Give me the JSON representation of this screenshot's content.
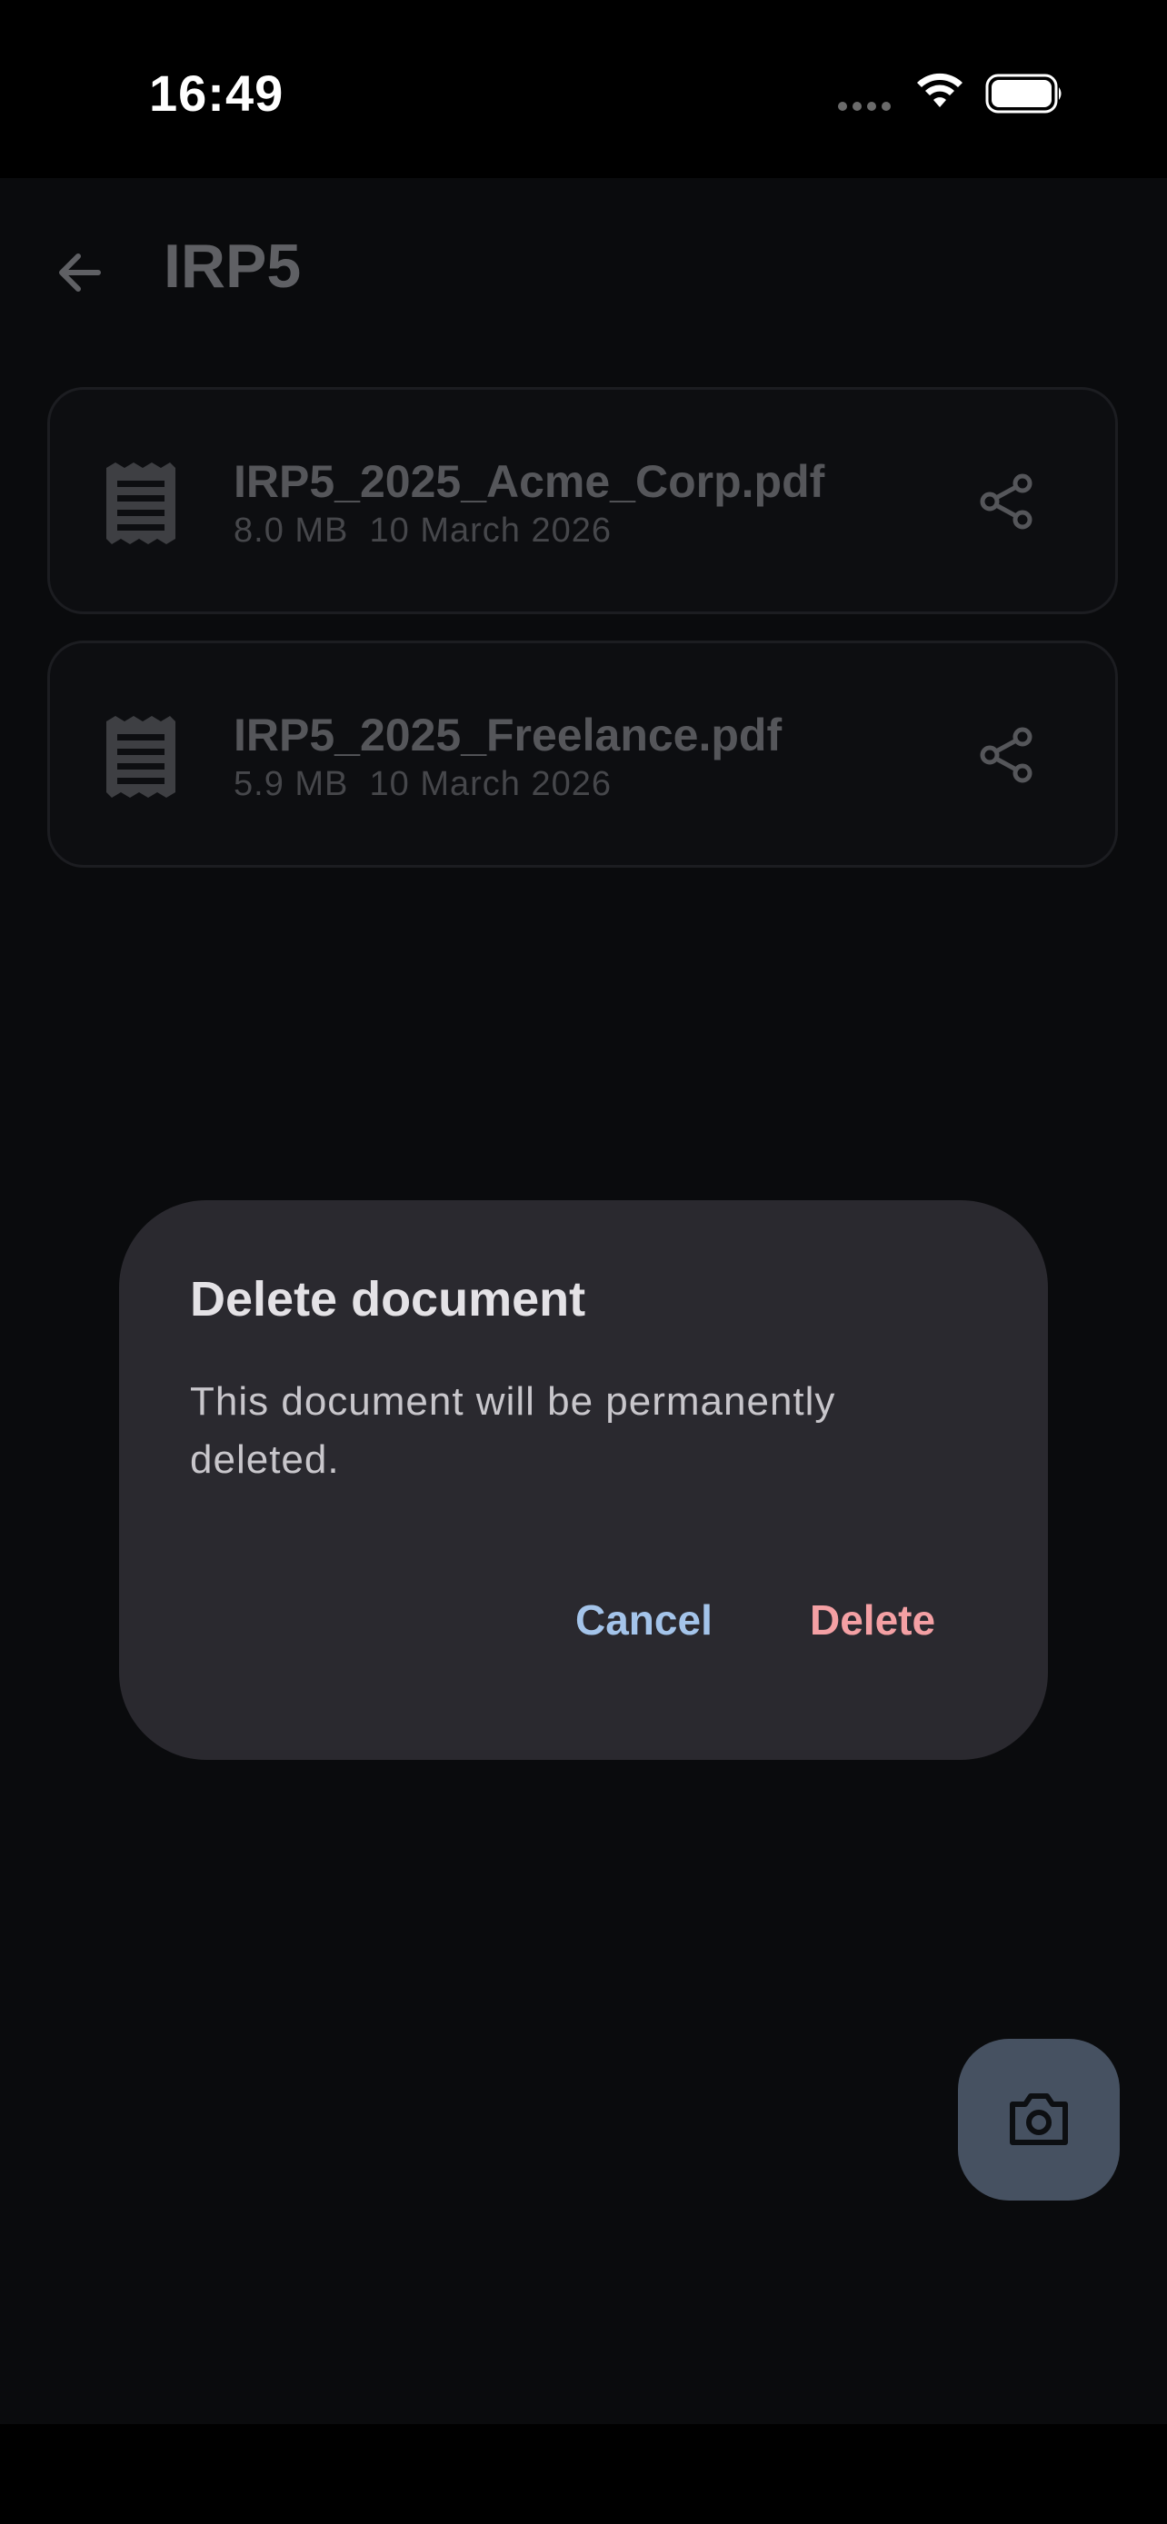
{
  "status_bar": {
    "time": "16:49",
    "signal_icon": "signal-dots-icon",
    "wifi_icon": "wifi-icon",
    "battery_icon": "battery-icon"
  },
  "header": {
    "back_icon": "arrow-left-icon",
    "title": "IRP5"
  },
  "documents": [
    {
      "icon": "receipt-icon",
      "name": "IRP5_2025_Acme_Corp.pdf",
      "meta": "8.0 MB  10 March 2026",
      "share_icon": "share-icon"
    },
    {
      "icon": "receipt-icon",
      "name": "IRP5_2025_Freelance.pdf",
      "meta": "5.9 MB  10 March 2026",
      "share_icon": "share-icon"
    }
  ],
  "dialog": {
    "title": "Delete document",
    "message": "This document will be permanently deleted.",
    "cancel_label": "Cancel",
    "delete_label": "Delete"
  },
  "fab": {
    "icon": "camera-icon"
  },
  "colors": {
    "background": "#0a0b0d",
    "dialog_surface": "#2a292f",
    "cancel_accent": "#a4c4ea",
    "delete_accent": "#f4a0a4",
    "fab_background": "#465161"
  }
}
